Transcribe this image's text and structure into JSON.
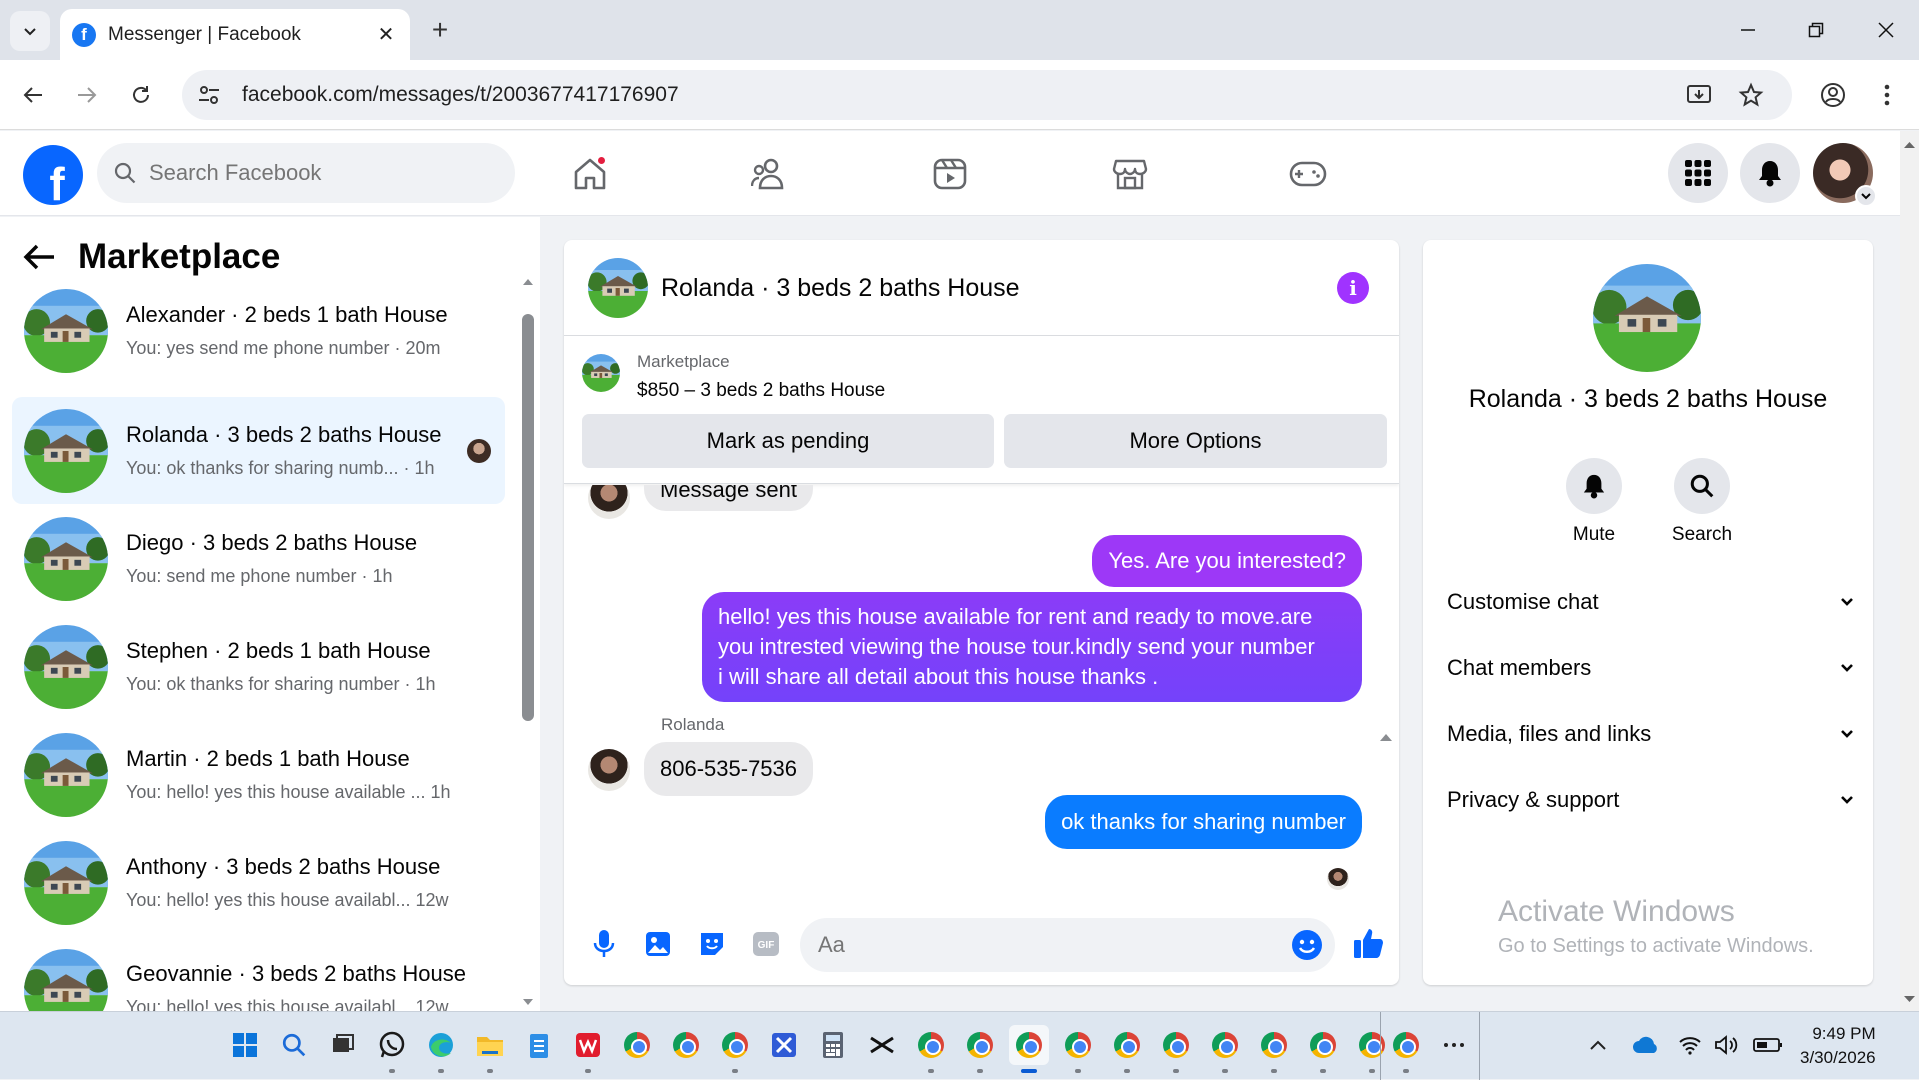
{
  "browser": {
    "tab_title": "Messenger | Facebook",
    "url": "facebook.com/messages/t/2003677417176907"
  },
  "facebook": {
    "search_placeholder": "Search Facebook"
  },
  "left_panel": {
    "title": "Marketplace",
    "conversations": [
      {
        "name": "Alexander · 2 beds 1 bath House",
        "last": "You: yes send me phone number · 20m",
        "active": false
      },
      {
        "name": "Rolanda · 3 beds 2 baths House",
        "last": "You: ok thanks for sharing numb... · 1h",
        "active": true
      },
      {
        "name": "Diego · 3 beds 2 baths House",
        "last": "You: send me phone number · 1h",
        "active": false
      },
      {
        "name": "Stephen · 2 beds 1 bath House",
        "last": "You: ok thanks for sharing number · 1h",
        "active": false
      },
      {
        "name": "Martin · 2 beds 1 bath House",
        "last": "You: hello! yes this house available ...   1h",
        "active": false
      },
      {
        "name": "Anthony · 3 beds 2 baths House",
        "last": "You: hello! yes this house availabl...   12w",
        "active": false
      },
      {
        "name": "Geovannie · 3 beds 2 baths House",
        "last": "You: hello! yes this house availabl...   12w",
        "active": false
      }
    ]
  },
  "chat": {
    "title": "Rolanda · 3 beds 2 baths House",
    "listing": {
      "source": "Marketplace",
      "price_line": "$850 – 3 beds 2 baths House",
      "mark_pending": "Mark as pending",
      "more_options": "More Options"
    },
    "messages": {
      "partial_in": "Message sent",
      "out1": "Yes. Are you interested?",
      "out2_lines": [
        "hello! yes this house available for rent and ready to move.are",
        "you intrested viewing the house tour.kindly send your number",
        "i will share all detail about this house thanks ."
      ],
      "sender": "Rolanda",
      "in_number": "806-535-7536",
      "out3": "ok thanks for sharing number"
    },
    "composer_placeholder": "Aa"
  },
  "right_panel": {
    "name": "Rolanda · 3 beds 2 baths House",
    "mute": "Mute",
    "search": "Search",
    "rows": [
      "Customise chat",
      "Chat members",
      "Media, files and links",
      "Privacy & support"
    ],
    "watermark_title": "Activate Windows",
    "watermark_sub": "Go to Settings to activate Windows."
  },
  "taskbar": {
    "time": "9:49 PM",
    "date": "3/30/2026"
  },
  "colors": {
    "brand": "#0866ff",
    "outgoing_bubble": "#0a7cff",
    "outgoing_gradient_top": "#a033ff",
    "active_conv": "#ebf5ff"
  }
}
